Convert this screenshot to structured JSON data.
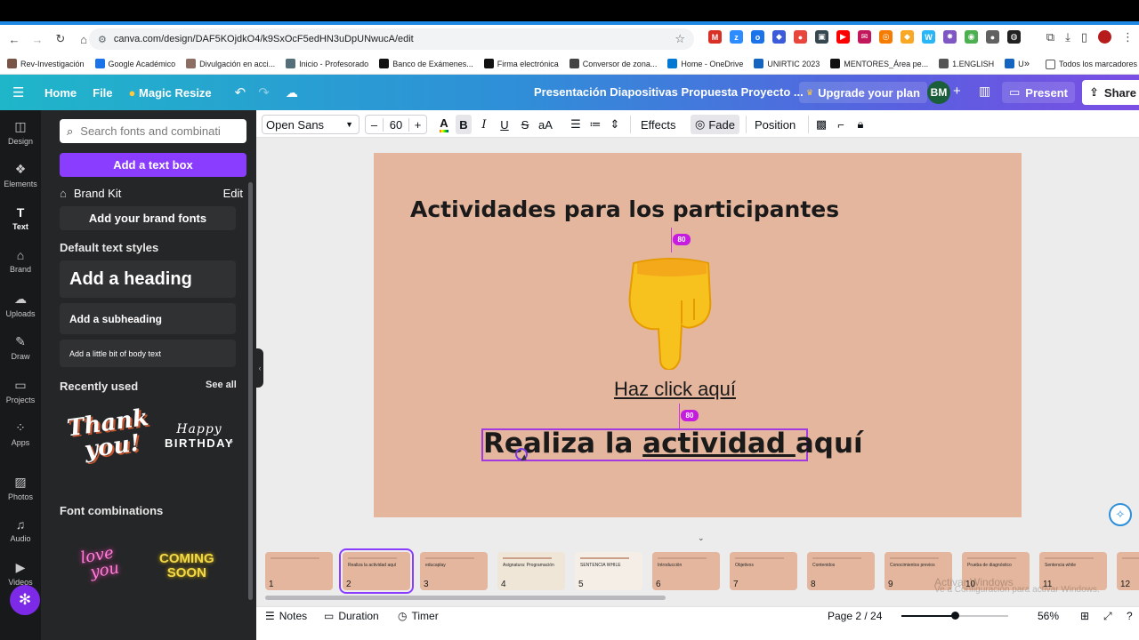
{
  "browser": {
    "url": "canva.com/design/DAF5KOjdkO4/k9SxOcF5edHN3uDpUNwucA/edit",
    "extensions": [
      {
        "icon": "gmail-icon",
        "color": "#d93025",
        "glyph": "M"
      },
      {
        "icon": "zoom-icon",
        "color": "#2d8cff",
        "glyph": "z"
      },
      {
        "icon": "ext-blue-icon",
        "color": "#1a73e8",
        "glyph": "o"
      },
      {
        "icon": "ext-shield-icon",
        "color": "#3b5bdb",
        "glyph": "◆"
      },
      {
        "icon": "ext-red-icon",
        "color": "#e8453c",
        "glyph": "●"
      },
      {
        "icon": "ext-dark-icon",
        "color": "#37474f",
        "glyph": "▣"
      },
      {
        "icon": "youtube-icon",
        "color": "#ff0000",
        "glyph": "▶"
      },
      {
        "icon": "ext-mail-icon",
        "color": "#c2185b",
        "glyph": "✉"
      },
      {
        "icon": "ext-orange-icon",
        "color": "#f57c00",
        "glyph": "◎"
      },
      {
        "icon": "ext-yellow-icon",
        "color": "#f9a825",
        "glyph": "◆"
      },
      {
        "icon": "word-icon",
        "color": "#29b6f6",
        "glyph": "W"
      },
      {
        "icon": "ext-purple-icon",
        "color": "#7e57c2",
        "glyph": "✸"
      },
      {
        "icon": "chrome-icon",
        "color": "#4caf50",
        "glyph": "◉"
      },
      {
        "icon": "ext-gray-icon",
        "color": "#616161",
        "glyph": "●"
      },
      {
        "icon": "ext-black-icon",
        "color": "#212121",
        "glyph": "◍"
      }
    ],
    "bookmarks": [
      {
        "label": "Rev-Investigación",
        "color": "#795548"
      },
      {
        "label": "Google Académico",
        "color": "#1a73e8"
      },
      {
        "label": "Divulgación en acci...",
        "color": "#8d6e63"
      },
      {
        "label": "Inicio - Profesorado",
        "color": "#546e7a"
      },
      {
        "label": "Banco de Exámenes...",
        "color": "#111111"
      },
      {
        "label": "Firma electrónica",
        "color": "#111111"
      },
      {
        "label": "Conversor de zona...",
        "color": "#444444"
      },
      {
        "label": "Home - OneDrive",
        "color": "#0078d4"
      },
      {
        "label": "UNIRTIC 2023",
        "color": "#1565c0"
      },
      {
        "label": "MENTORES_Área pe...",
        "color": "#111111"
      },
      {
        "label": "1.ENGLISH",
        "color": "#555555"
      },
      {
        "label": "UNIR Grupos de Inv...",
        "color": "#1565c0"
      }
    ],
    "bookmarks_more": "»",
    "all_bookmarks": "Todos los marcadores"
  },
  "header": {
    "home": "Home",
    "file": "File",
    "magic_resize": "Magic Resize",
    "title": "Presentación Diapositivas Propuesta Proyecto ...",
    "upgrade": "Upgrade your plan",
    "avatar_initials": "BM",
    "present": "Present",
    "share": "Share"
  },
  "rail": [
    {
      "label": "Design",
      "icon": "design-icon",
      "glyph": "◫"
    },
    {
      "label": "Elements",
      "icon": "elements-icon",
      "glyph": "❖"
    },
    {
      "label": "Text",
      "icon": "text-icon",
      "glyph": "T"
    },
    {
      "label": "Brand",
      "icon": "brand-icon",
      "glyph": "⌂"
    },
    {
      "label": "Uploads",
      "icon": "uploads-icon",
      "glyph": "☁"
    },
    {
      "label": "Draw",
      "icon": "draw-icon",
      "glyph": "✎"
    },
    {
      "label": "Projects",
      "icon": "projects-icon",
      "glyph": "▭"
    },
    {
      "label": "Apps",
      "icon": "apps-icon",
      "glyph": "⁘"
    },
    {
      "label": "Photos",
      "icon": "photos-icon",
      "glyph": "▨"
    },
    {
      "label": "Audio",
      "icon": "audio-icon",
      "glyph": "♫"
    },
    {
      "label": "Videos",
      "icon": "videos-icon",
      "glyph": "▶"
    }
  ],
  "panel": {
    "search_placeholder": "Search fonts and combinati",
    "add_text_box": "Add a text box",
    "brand_kit": "Brand Kit",
    "brand_kit_edit": "Edit",
    "add_brand_fonts": "Add your brand fonts",
    "default_styles_title": "Default text styles",
    "heading": "Add a heading",
    "subheading": "Add a subheading",
    "body": "Add a little bit of body text",
    "recently_used": "Recently used",
    "see_all": "See all",
    "recent_1_line1": "Thank",
    "recent_1_line2": "you!",
    "recent_2_line1": "Happy",
    "recent_2_line2": "BIRTHDAY",
    "font_combinations": "Font combinations",
    "combo_1_line1": "love",
    "combo_1_line2": "you",
    "combo_2_line1": "COMING",
    "combo_2_line2": "SOON"
  },
  "toolbar": {
    "font": "Open Sans",
    "minus": "–",
    "size": "60",
    "plus": "+",
    "bold": "B",
    "italic": "I",
    "underline": "U",
    "strike": "S",
    "case": "aA",
    "effects": "Effects",
    "fade": "Fade",
    "position": "Position"
  },
  "slide": {
    "heading": "Actividades para los participantes",
    "link_text": "Haz click aquí",
    "activity_part1": "Realiza la ",
    "activity_part2": "actividad ",
    "activity_part3": "aquí",
    "spacing_top": "80",
    "spacing_bottom": "80",
    "background": "#e4b69d"
  },
  "thumbnails": [
    {
      "num": "1",
      "label": ""
    },
    {
      "num": "2",
      "label": "Realiza la actividad aquí"
    },
    {
      "num": "3",
      "label": "educaplay"
    },
    {
      "num": "4",
      "label": "Asignatura: Programación"
    },
    {
      "num": "5",
      "label": "SENTENCIA WHILE"
    },
    {
      "num": "6",
      "label": "Introducción"
    },
    {
      "num": "7",
      "label": "Objetivos"
    },
    {
      "num": "8",
      "label": "Contenidos"
    },
    {
      "num": "9",
      "label": "Conocimientos previos"
    },
    {
      "num": "10",
      "label": "Prueba de diagnóstico"
    },
    {
      "num": "11",
      "label": "Sentencia while"
    },
    {
      "num": "12",
      "label": ""
    }
  ],
  "watermark": {
    "line1": "Activar Windows",
    "line2": "Ve a Configuración para activar Windows."
  },
  "footer": {
    "notes": "Notes",
    "duration": "Duration",
    "timer": "Timer",
    "page": "Page 2 / 24",
    "zoom_level": "56%",
    "zoom_fraction": 0.5
  }
}
